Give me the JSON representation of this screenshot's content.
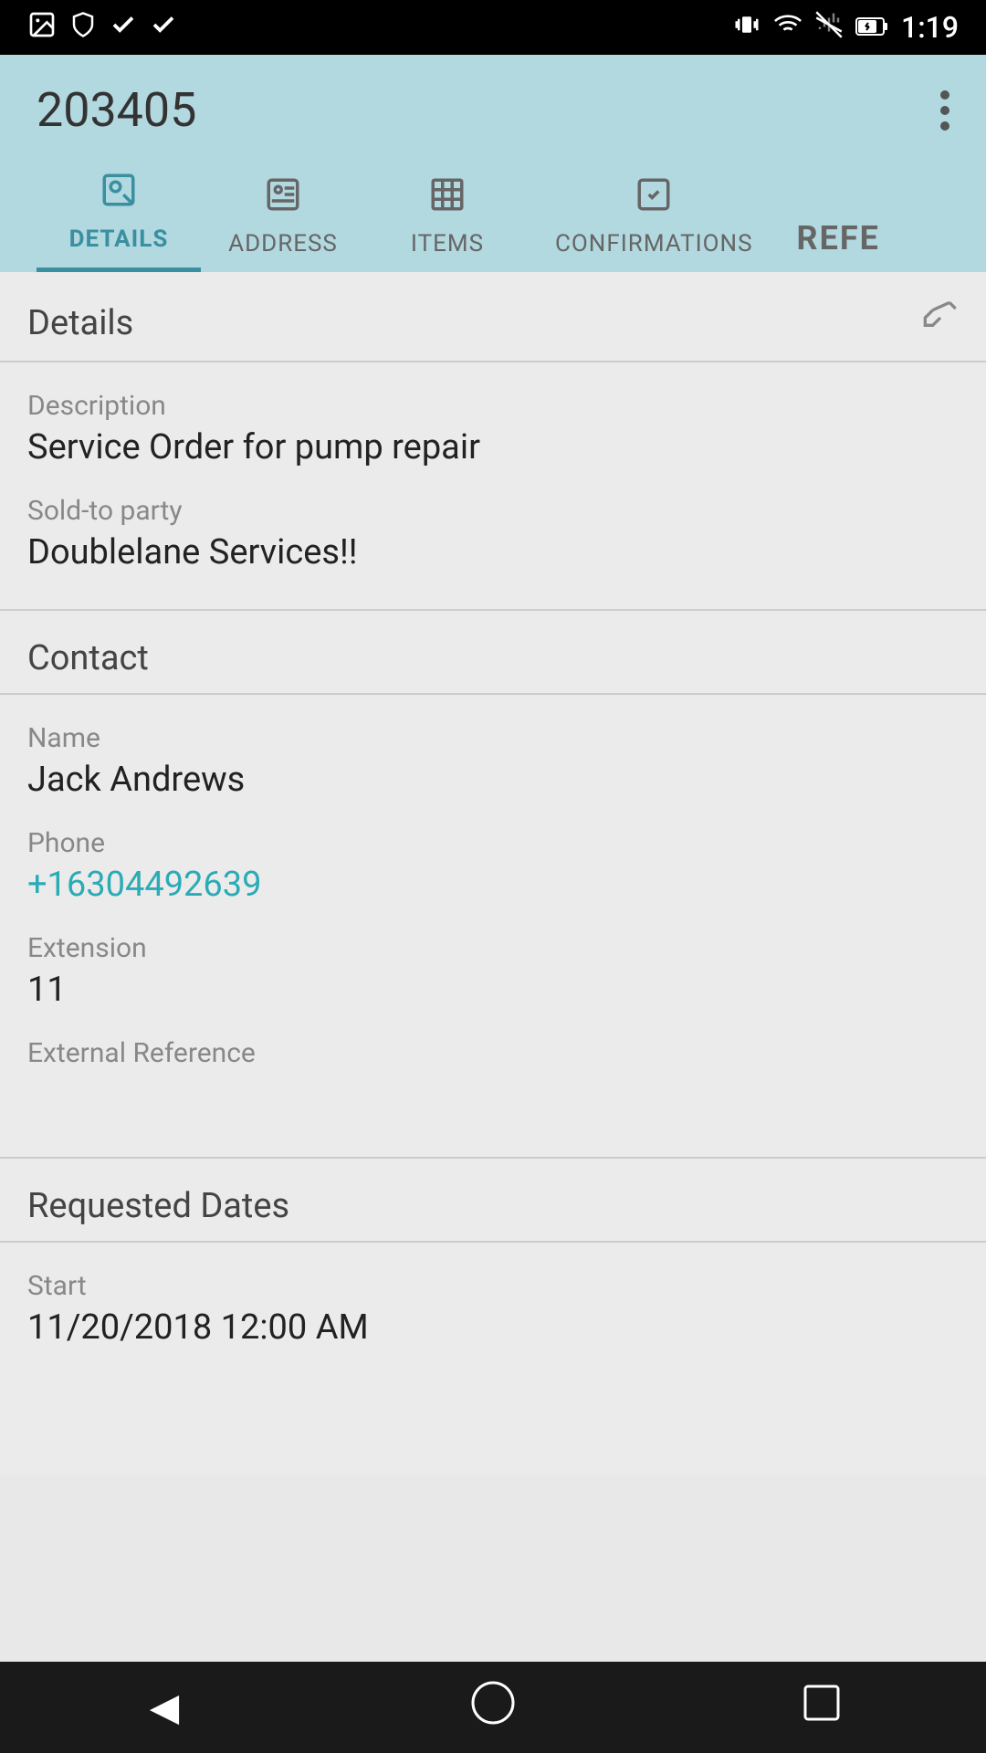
{
  "statusBar": {
    "time": "1:19",
    "icons": [
      "image",
      "shield",
      "check",
      "check",
      "vibrate",
      "wifi",
      "signal-off",
      "battery"
    ]
  },
  "header": {
    "title": "203405",
    "moreMenuLabel": "more options"
  },
  "tabs": [
    {
      "id": "details",
      "label": "DETAILS",
      "active": true
    },
    {
      "id": "address",
      "label": "ADDRESS",
      "active": false
    },
    {
      "id": "items",
      "label": "ITEMS",
      "active": false
    },
    {
      "id": "confirmations",
      "label": "CONFIRMATIONS",
      "active": false
    },
    {
      "id": "refe",
      "label": "REFE",
      "active": false
    }
  ],
  "sections": {
    "details": {
      "title": "Details",
      "fields": [
        {
          "label": "Description",
          "value": "Service Order for pump repair",
          "type": "text"
        },
        {
          "label": "Sold-to party",
          "value": "Doublelane Services!!",
          "type": "text"
        }
      ]
    },
    "contact": {
      "title": "Contact",
      "fields": [
        {
          "label": "Name",
          "value": "Jack Andrews",
          "type": "text"
        },
        {
          "label": "Phone",
          "value": "+16304492639",
          "type": "link"
        },
        {
          "label": "Extension",
          "value": "11",
          "type": "text"
        },
        {
          "label": "External Reference",
          "value": "",
          "type": "text"
        }
      ]
    },
    "requestedDates": {
      "title": "Requested Dates",
      "fields": [
        {
          "label": "Start",
          "value": "11/20/2018 12:00 AM",
          "type": "text"
        }
      ]
    }
  },
  "bottomNav": {
    "back": "◀",
    "home": "⬤",
    "recent": "■"
  }
}
